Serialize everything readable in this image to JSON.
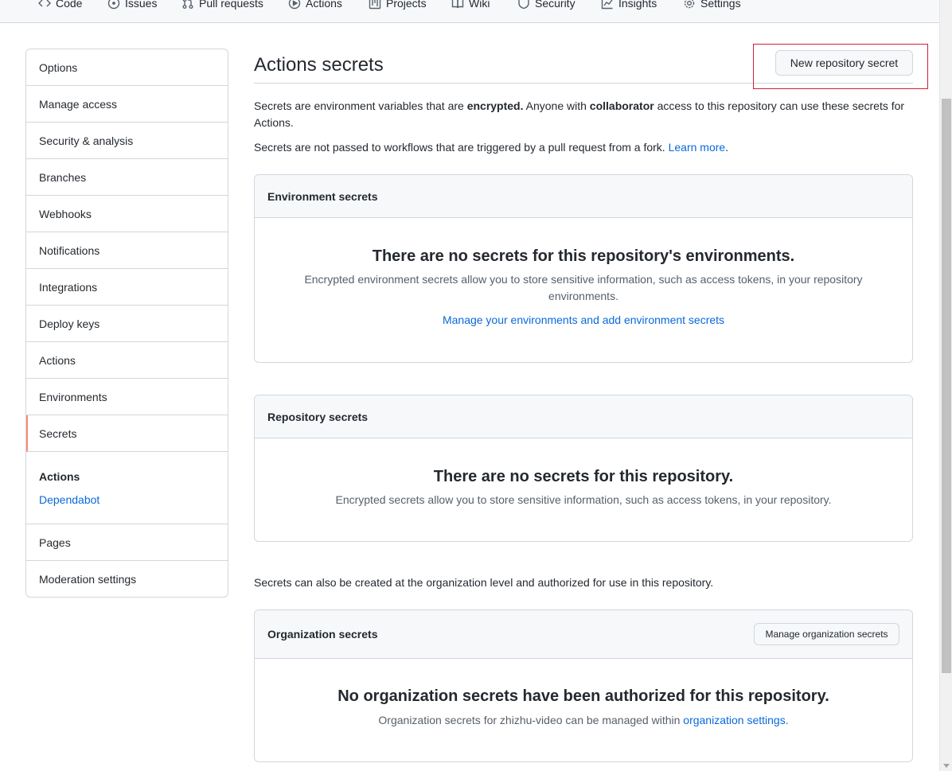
{
  "nav": {
    "tabs": [
      {
        "label": "Code",
        "icon": "code-icon"
      },
      {
        "label": "Issues",
        "icon": "issue-opened-icon"
      },
      {
        "label": "Pull requests",
        "icon": "git-pull-request-icon"
      },
      {
        "label": "Actions",
        "icon": "play-icon"
      },
      {
        "label": "Projects",
        "icon": "project-icon"
      },
      {
        "label": "Wiki",
        "icon": "book-icon"
      },
      {
        "label": "Security",
        "icon": "shield-icon"
      },
      {
        "label": "Insights",
        "icon": "graph-icon"
      },
      {
        "label": "Settings",
        "icon": "gear-icon"
      }
    ]
  },
  "sidebar": {
    "items": [
      {
        "label": "Options"
      },
      {
        "label": "Manage access"
      },
      {
        "label": "Security & analysis"
      },
      {
        "label": "Branches"
      },
      {
        "label": "Webhooks"
      },
      {
        "label": "Notifications"
      },
      {
        "label": "Integrations"
      },
      {
        "label": "Deploy keys"
      },
      {
        "label": "Actions"
      },
      {
        "label": "Environments"
      },
      {
        "label": "Secrets"
      }
    ],
    "sub_heading": "Actions",
    "sub_link": "Dependabot",
    "after_items": [
      {
        "label": "Pages"
      },
      {
        "label": "Moderation settings"
      }
    ],
    "accent_color": "#fd8c73"
  },
  "main": {
    "title": "Actions secrets",
    "new_secret_button": "New repository secret",
    "intro": {
      "p1_a": "Secrets are environment variables that are ",
      "p1_b": "encrypted.",
      "p1_c": " Anyone with ",
      "p1_d": "collaborator",
      "p1_e": " access to this repository can use these secrets for Actions.",
      "p2_a": "Secrets are not passed to workflows that are triggered by a pull request from a fork. ",
      "p2_link": "Learn more",
      "p2_end": "."
    },
    "environment": {
      "header": "Environment secrets",
      "blank_title": "There are no secrets for this repository's environments.",
      "blank_desc": "Encrypted environment secrets allow you to store sensitive information, such as access tokens, in your repository environments.",
      "link": "Manage your environments and add environment secrets"
    },
    "repository": {
      "header": "Repository secrets",
      "blank_title": "There are no secrets for this repository.",
      "blank_desc": "Encrypted secrets allow you to store sensitive information, such as access tokens, in your repository."
    },
    "org_note": "Secrets can also be created at the organization level and authorized for use in this repository.",
    "organization": {
      "header": "Organization secrets",
      "button": "Manage organization secrets",
      "blank_title": "No organization secrets have been authorized for this repository.",
      "blank_desc_a": "Organization secrets for zhizhu-video can be managed within ",
      "blank_link": "organization settings",
      "blank_desc_end": "."
    },
    "link_color": "#0969da",
    "highlight_color": "#d0213a"
  }
}
